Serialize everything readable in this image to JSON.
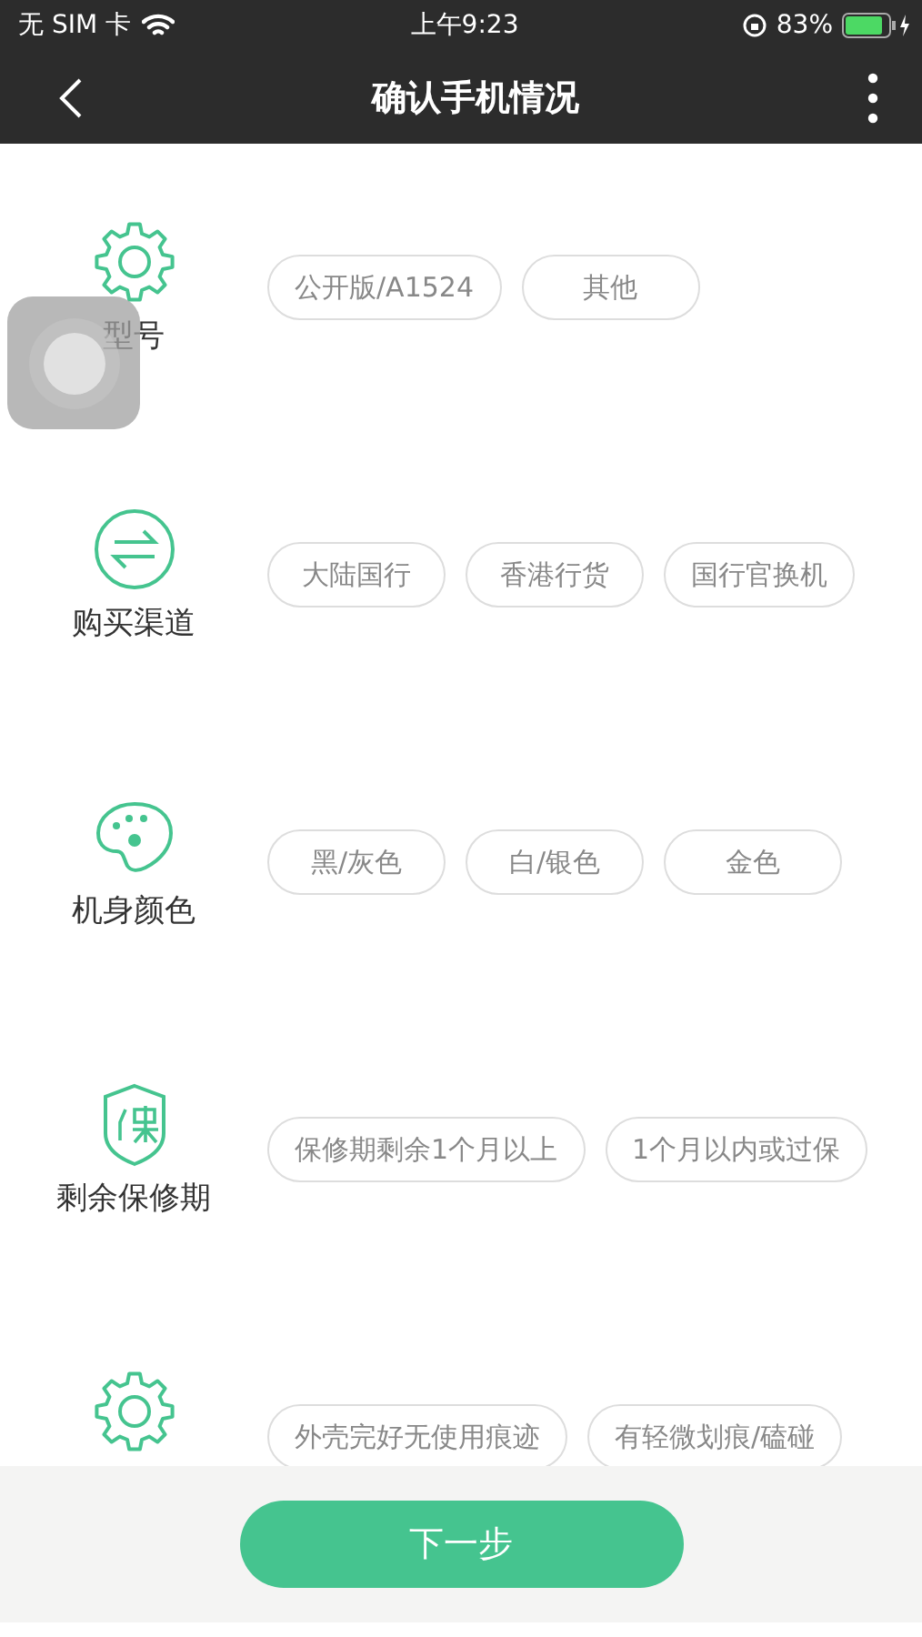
{
  "status_bar": {
    "carrier": "无 SIM 卡",
    "time": "上午9:23",
    "battery": "83%"
  },
  "nav_bar": {
    "title": "确认手机情况"
  },
  "sections": [
    {
      "kind": "gear",
      "label": "型号",
      "options": [
        {
          "label": "公开版/A1524",
          "selected": false
        },
        {
          "label": "其他",
          "selected": false
        }
      ]
    },
    {
      "kind": "exchange",
      "label": "购买渠道",
      "options": [
        {
          "label": "大陆国行",
          "selected": false
        },
        {
          "label": "香港行货",
          "selected": false
        },
        {
          "label": "国行官换机",
          "selected": false
        }
      ]
    },
    {
      "kind": "palette",
      "label": "机身颜色",
      "options": [
        {
          "label": "黑/灰色",
          "selected": false
        },
        {
          "label": "白/银色",
          "selected": false
        },
        {
          "label": "金色",
          "selected": false
        }
      ]
    },
    {
      "kind": "shield",
      "label": "剩余保修期",
      "options": [
        {
          "label": "保修期剩余1个月以上",
          "selected": false
        },
        {
          "label": "1个月以内或过保",
          "selected": false
        }
      ]
    },
    {
      "kind": "gear",
      "options": [
        {
          "label": "外壳完好无使用痕迹",
          "selected": false
        },
        {
          "label": "有轻微划痕/磕碰",
          "selected": false
        }
      ]
    }
  ],
  "footer": {
    "button": "下一步"
  }
}
